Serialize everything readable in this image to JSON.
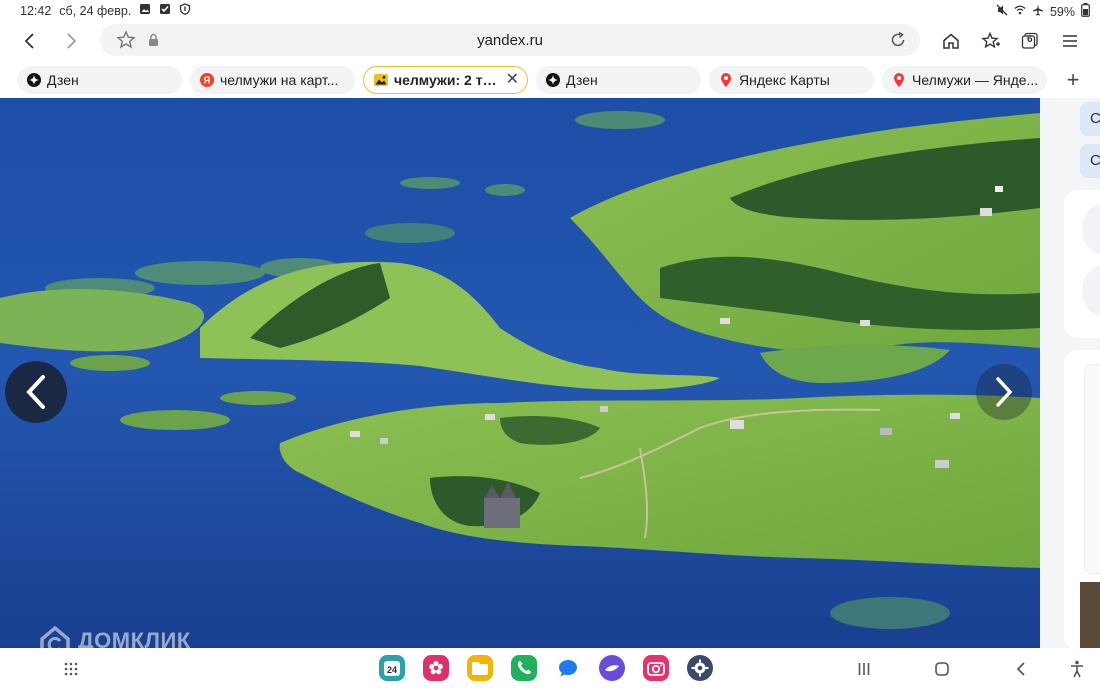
{
  "status_bar": {
    "time": "12:42",
    "date": "сб, 24 февр.",
    "battery": "59%"
  },
  "browser": {
    "url": "yandex.ru",
    "tabs_count": "6"
  },
  "tabs": [
    {
      "label": "Дзен",
      "icon": "dzen-icon"
    },
    {
      "label": "челмужи на карт...",
      "icon": "yandex-icon"
    },
    {
      "label": "челмужи: 2 ты...",
      "icon": "images-icon"
    },
    {
      "label": "Дзен",
      "icon": "dzen-icon"
    },
    {
      "label": "Яндекс Карты",
      "icon": "map-pin-icon"
    },
    {
      "label": "Челмужи — Янде...",
      "icon": "map-pin-icon"
    }
  ],
  "viewer": {
    "watermark": "ДОМКЛИК"
  },
  "side_panel": {
    "chip_1": "С",
    "chip_2": "С"
  },
  "colors": {
    "active_tab_border": "#f0c020",
    "water": "#1f4fa8",
    "land": "#7fb34a"
  }
}
